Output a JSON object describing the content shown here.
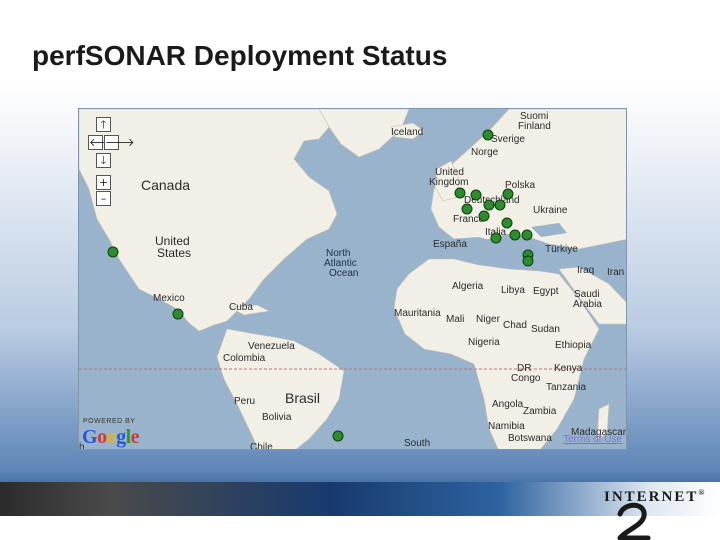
{
  "slide": {
    "title": "perfSONAR Deployment Status"
  },
  "map": {
    "labels": {
      "suomi": "Suomi",
      "finland": "Finland",
      "iceland": "Iceland",
      "sverige": "Sverige",
      "norge": "Norge",
      "united": "United",
      "kingdom": "Kingdom",
      "polska": "Polska",
      "deutschland": "Deutschland",
      "ukraine": "Ukraine",
      "france": "France",
      "italia": "Italia",
      "espana": "España",
      "turkiye": "Türkiye",
      "iraq": "Iraq",
      "iran": "Iran",
      "canada": "Canada",
      "united_states_1": "United",
      "united_states_2": "States",
      "north": "North",
      "atlantic": "Atlantic",
      "ocean": "Ocean",
      "algeria": "Algeria",
      "libya": "Libya",
      "egypt": "Egypt",
      "saudi": "Saudi",
      "arabia": "Arabia",
      "mexico": "Mexico",
      "cuba": "Cuba",
      "mauritania": "Mauritania",
      "mali": "Mali",
      "niger": "Niger",
      "chad": "Chad",
      "sudan": "Sudan",
      "venezuela": "Venezuela",
      "colombia": "Colombia",
      "nigeria": "Nigeria",
      "ethiopia": "Ethiopia",
      "dr": "DR",
      "congo": "Congo",
      "kenya": "Kenya",
      "tanzania": "Tanzania",
      "peru": "Peru",
      "brasil": "Brasil",
      "angola": "Angola",
      "zambia": "Zambia",
      "bolivia": "Bolivia",
      "namibia": "Namibia",
      "madagascar": "Madagascar",
      "botswana": "Botswana",
      "chile": "Chile",
      "south": "South",
      "h_cut": "h"
    },
    "markers": [
      {
        "id": "sweden"
      },
      {
        "id": "uk-1"
      },
      {
        "id": "uk-2"
      },
      {
        "id": "poland"
      },
      {
        "id": "germany-1"
      },
      {
        "id": "germany-2"
      },
      {
        "id": "germany-3"
      },
      {
        "id": "france"
      },
      {
        "id": "switzerland"
      },
      {
        "id": "czech"
      },
      {
        "id": "croatia"
      },
      {
        "id": "italy"
      },
      {
        "id": "balkans"
      },
      {
        "id": "romania"
      },
      {
        "id": "greece-1"
      },
      {
        "id": "greece-2"
      },
      {
        "id": "california"
      },
      {
        "id": "central-america"
      },
      {
        "id": "brazil"
      }
    ],
    "controls": {
      "pan_up": "🡑",
      "pan_left": "🡐",
      "pan_right": "🡒",
      "pan_down": "🡓",
      "zoom_in": "+",
      "zoom_out": "–"
    },
    "attribution": {
      "powered_by": "POWERED BY",
      "google": [
        "G",
        "o",
        "o",
        "g",
        "l",
        "e"
      ],
      "google_colors": [
        "#2a55d6",
        "#d63a2a",
        "#e8b30f",
        "#2a55d6",
        "#2a9a2a",
        "#d63a2a"
      ],
      "terms": "Terms of Use"
    },
    "colors": {
      "water": "#99b3cc",
      "land": "#f2efe6",
      "marker": "#2e8b2e"
    }
  },
  "footer": {
    "logo_text": "INTERNET",
    "logo_reg": "®"
  }
}
